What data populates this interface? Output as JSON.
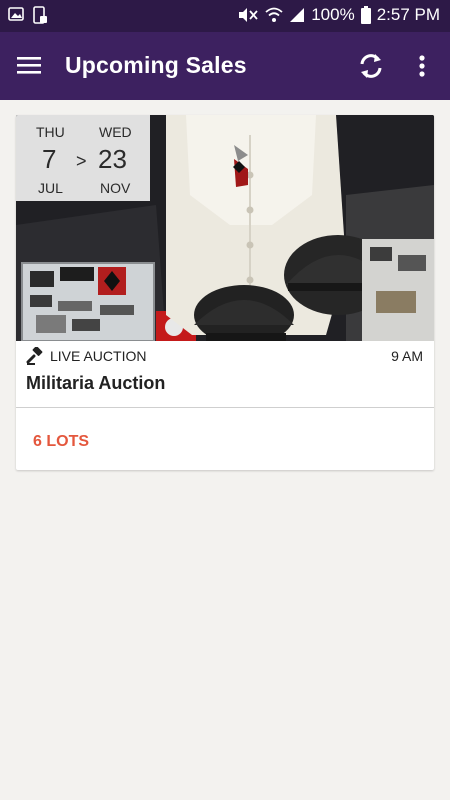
{
  "status_bar": {
    "battery": "100%",
    "time": "2:57 PM"
  },
  "app_bar": {
    "title": "Upcoming Sales"
  },
  "sale": {
    "start": {
      "day_of_week": "THU",
      "day": "7",
      "month": "JUL"
    },
    "separator": ">",
    "end": {
      "day_of_week": "WED",
      "day": "23",
      "month": "NOV"
    },
    "type": "LIVE AUCTION",
    "time": "9 AM",
    "title": "Militaria Auction",
    "lots": "6 LOTS"
  },
  "colors": {
    "status_bar": "#2d1947",
    "app_bar": "#3d2160",
    "accent": "#e4573d",
    "background": "#f3f2ef"
  }
}
